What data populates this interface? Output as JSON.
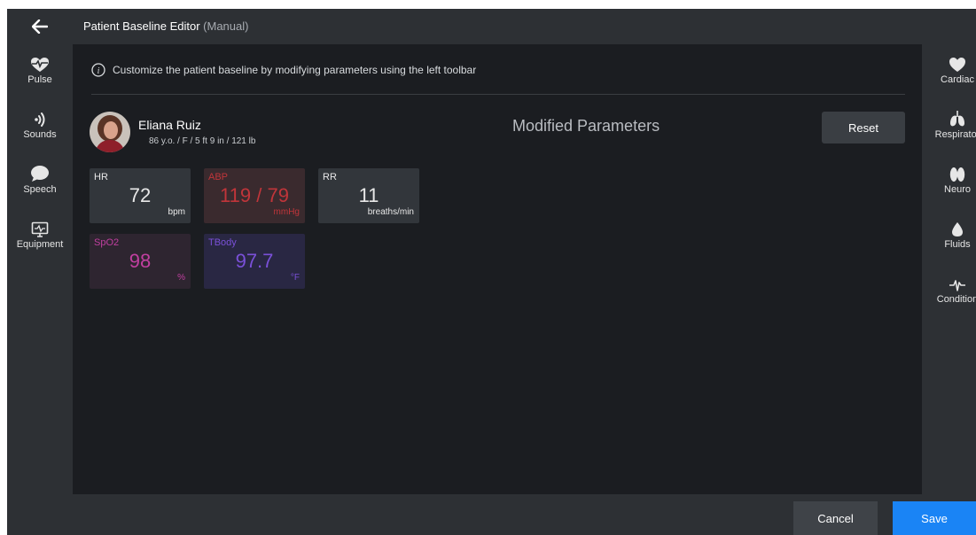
{
  "header": {
    "back_icon": "arrow-left-icon",
    "title": "Patient Baseline Editor",
    "subtitle": "(Manual)"
  },
  "left_nav": [
    {
      "label": "Pulse",
      "icon": "heart-pulse-icon"
    },
    {
      "label": "Sounds",
      "icon": "sound-waves-icon"
    },
    {
      "label": "Speech",
      "icon": "speech-bubble-icon"
    },
    {
      "label": "Equipment",
      "icon": "monitor-icon"
    }
  ],
  "right_nav": [
    {
      "label": "Cardiac",
      "icon": "heart-icon"
    },
    {
      "label": "Respirator",
      "icon": "lungs-icon"
    },
    {
      "label": "Neuro",
      "icon": "brain-icon"
    },
    {
      "label": "Fluids",
      "icon": "drop-icon"
    },
    {
      "label": "Condition",
      "icon": "waveform-icon"
    }
  ],
  "info_text": "Customize the patient baseline by modifying parameters using the left toolbar",
  "patient": {
    "name": "Eliana Ruiz",
    "details": "86 y.o. / F / 5 ft 9 in / 121 lb"
  },
  "modified_parameters_title": "Modified Parameters",
  "reset_label": "Reset",
  "vitals": {
    "hr": {
      "label": "HR",
      "value": "72",
      "unit": "bpm"
    },
    "abp": {
      "label": "ABP",
      "value": "119 / 79",
      "unit": "mmHg"
    },
    "rr": {
      "label": "RR",
      "value": "11",
      "unit": "breaths/min"
    },
    "spo2": {
      "label": "SpO2",
      "value": "98",
      "unit": "%"
    },
    "tbody": {
      "label": "TBody",
      "value": "97.7",
      "unit": "°F"
    }
  },
  "colors": {
    "abp": "#c0353a",
    "spo2": "#c13fa0",
    "tbody": "#7a50d8",
    "save": "#1a84f5"
  },
  "footer": {
    "cancel_label": "Cancel",
    "save_label": "Save"
  }
}
